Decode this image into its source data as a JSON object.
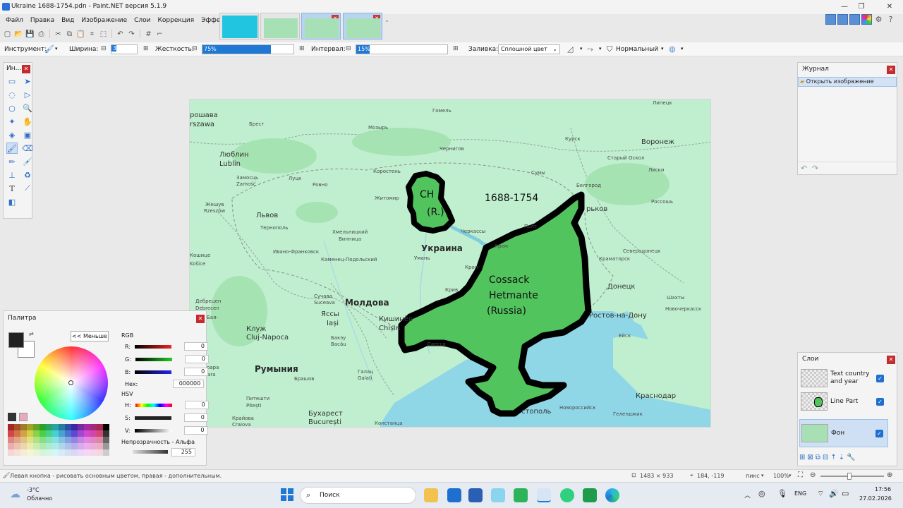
{
  "window": {
    "title": "Ukraine 1688-1754.pdn - Paint.NET версия 5.1.9"
  },
  "menu": [
    "Файл",
    "Правка",
    "Вид",
    "Изображение",
    "Слои",
    "Коррекция",
    "Эффекты"
  ],
  "toolbar": {
    "tool_label": "Инструмент:",
    "width_label": "Ширина:",
    "width_value": "3",
    "hardness_label": "Жесткость:",
    "hardness_value": "75%",
    "hardness_fraction": 0.75,
    "interval_label": "Интервал:",
    "interval_value": "15%",
    "interval_fraction": 0.15,
    "fill_label": "Заливка:",
    "fill_value": "Сплошной цвет",
    "blend_mode": "Нормальный"
  },
  "tools_panel": {
    "title": "Ин..."
  },
  "history_panel": {
    "title": "Журнал",
    "items": [
      "Открыть изображение"
    ]
  },
  "layers_panel": {
    "title": "Слои",
    "layers": [
      {
        "name": "Text country and year",
        "visible": true
      },
      {
        "name": "Line Part",
        "visible": true
      },
      {
        "name": "Фон",
        "visible": true
      }
    ]
  },
  "palette_panel": {
    "title": "Палитра",
    "less_button": "<< Меньше",
    "rgb_label": "RGB",
    "r_label": "R:",
    "g_label": "G:",
    "b_label": "B:",
    "r_value": "0",
    "g_value": "0",
    "b_value": "0",
    "hex_label": "Hex:",
    "hex_value": "000000",
    "hsv_label": "HSV",
    "h_label": "H:",
    "s_label": "S:",
    "v_label": "V:",
    "h_value": "0",
    "s_value": "0",
    "v_value": "0",
    "opacity_label": "Непрозрачность - Альфа",
    "opacity_value": "255"
  },
  "map": {
    "annotations": {
      "year": "1688-1754",
      "ch_line1": "CH",
      "ch_line2": "(R.)",
      "cossack_line1": "Cossack",
      "cossack_line2": "Hetmante",
      "cossack_line3": "(Russia)"
    },
    "labels": {
      "warszawa_pl": "рошава",
      "warszawa": "rszawa",
      "lublin_ru": "Люблин",
      "lublin": "Lublin",
      "zamosc_ru": "Замосць",
      "zamosc": "Zamość",
      "zheshuv": "Жешув",
      "rzeszow": "Rzeszów",
      "lviv": "Львов",
      "ternopil": "Тернополь",
      "ivano": "Ивано-Франковск",
      "suceava_ru": "Сучава",
      "suceava": "Suceava",
      "iasi_ru": "Яссы",
      "iasi": "Iași",
      "moldova": "Молдова",
      "chisinau_ru": "Кишинёв",
      "chisinau": "Chișin",
      "cluj_ru": "Клуж",
      "cluj": "Cluj-Napoca",
      "romania": "Румыния",
      "bucharest_ru": "Бухарест",
      "bucharest": "București",
      "pitesti_ru": "Питешти",
      "pitesti": "Pitești",
      "craiova_ru": "Крайова",
      "craiova": "Craiova",
      "constanta": "Констанца",
      "brest": "Брест",
      "mozyr": "Мозырь",
      "gomel": "Гомель",
      "lutsk": "Луцк",
      "rovno": "Ровно",
      "korosten": "Коростень",
      "zhytomyr": "Житомир",
      "chernigov": "Чернигов",
      "khmelnytskyi": "Хмельницкий",
      "vinnytsia": "Винница",
      "cherkassy": "Черкассы",
      "kamenets": "Каменец-Подольский",
      "uman": "Умань",
      "ukraine": "Украина",
      "odessa": "Одесса",
      "kursk": "Курск",
      "sumy": "Сумы",
      "belgorod": "Белгород",
      "stary_oskol": "Старый Оскол",
      "voronezh": "Воронеж",
      "liski": "Лиски",
      "lipetsk": "Липецк",
      "rossosh": "Россошь",
      "severodonetsk": "Северодонецк",
      "kramatorsk": "Краматорск",
      "donetsk": "Донецк",
      "shakhty": "Шахты",
      "novocherkassk": "Новочеркасск",
      "rostov": "Ростов-на-Дону",
      "eysk": "Ейск",
      "krasnodar": "Краснодар",
      "novorossiysk": "Новороссийск",
      "gelendzhik": "Геленджик",
      "sevastopol": "стополь",
      "kharkov": "рьков",
      "poltava": "Полт",
      "kremenchug": "Крем",
      "kropyvnytskyi": "Кроп",
      "kryvyi": "Крив",
      "debrecen_ru": "Дебрецен",
      "debrecen": "Debrecen",
      "kosice_ru": "Кошице",
      "kosice": "Košice",
      "baia_ru": "Бая-",
      "bacau_ru": "Бакэу",
      "bacau": "Bacău",
      "galati_ru": "Галац",
      "galati": "Galați",
      "brasov": "Брашов",
      "sighisoara": "Сигишоара",
      "sighisoara_lat": "Sighisoara"
    }
  },
  "status": {
    "hint": "Левая кнопка - рисовать основным цветом, правая - дополнительным.",
    "size": "1483 × 933",
    "coords": "184, -119",
    "units": "пикс",
    "zoom": "100%"
  },
  "taskbar": {
    "temp": "-3°C",
    "weather": "Облачно",
    "search": "Поиск",
    "lang": "ENG",
    "time": "17:56",
    "date": "27.02.2026"
  }
}
